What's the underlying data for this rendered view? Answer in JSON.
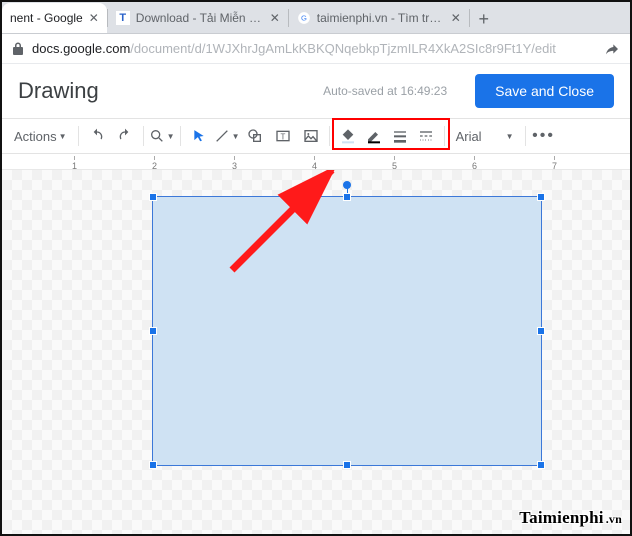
{
  "tabs": [
    {
      "label": "nent - Google",
      "kind": "docs"
    },
    {
      "label": "Download - Tải Miễn Phí VN",
      "kind": "T"
    },
    {
      "label": "taimienphi.vn - Tìm trên Goo",
      "kind": "G"
    }
  ],
  "url": {
    "host": "docs.google.com",
    "path": "/document/d/1WJXhrJgAmLkKBKQNqebkpTjzmILR4XkA2SIc8r9Ft1Y/edit"
  },
  "drawing": {
    "title": "Drawing",
    "autosave": "Auto-saved at 16:49:23",
    "save_close": "Save and Close"
  },
  "toolbar": {
    "actions": "Actions",
    "font": "Arial"
  },
  "ruler": {
    "nums": [
      "1",
      "2",
      "3",
      "4",
      "5",
      "6",
      "7"
    ]
  },
  "watermark": {
    "name": "Taimienphi",
    "tld": ".vn"
  }
}
